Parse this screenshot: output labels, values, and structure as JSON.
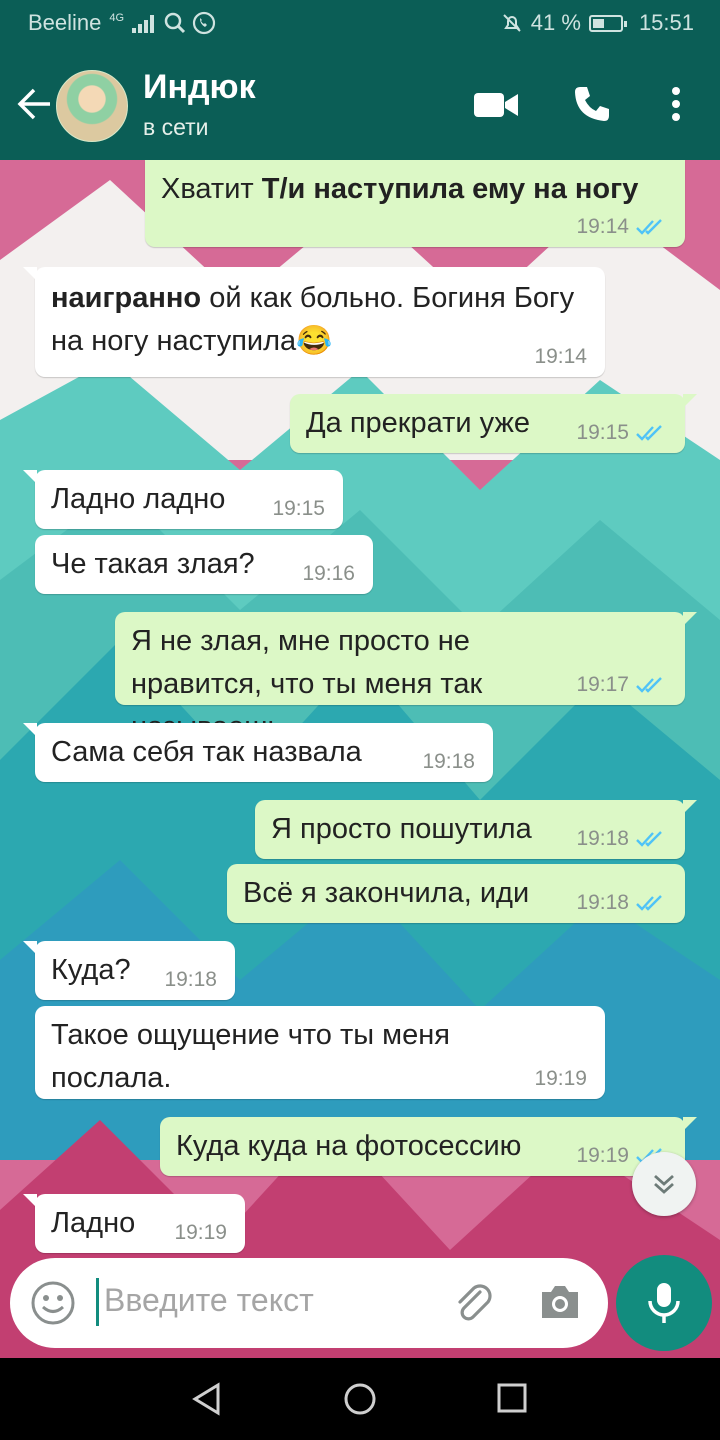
{
  "status_bar": {
    "carrier": "Beeline",
    "network": "4G",
    "battery_percent_text": "41 %",
    "battery_level": 0.41,
    "time": "15:51"
  },
  "header": {
    "contact_name": "Индюк",
    "presence": "в сети"
  },
  "messages": [
    {
      "dir": "out",
      "text": "Хватит ",
      "bold": "Т/и наступила ему на ногу",
      "time": "19:14"
    },
    {
      "dir": "in",
      "bold": "наигранно",
      "text": " ой как больно. Богиня Богу на ногу наступила",
      "emoji": "😂",
      "time": "19:14"
    },
    {
      "dir": "out",
      "text": "Да прекрати уже",
      "time": "19:15"
    },
    {
      "dir": "in",
      "text": "Ладно ладно",
      "time": "19:15"
    },
    {
      "dir": "in",
      "text": "Че такая злая?",
      "time": "19:16"
    },
    {
      "dir": "out",
      "text": "Я не злая, мне просто не нравится, что ты меня так называешь",
      "time": "19:17"
    },
    {
      "dir": "in",
      "text": "Сама себя так назвала",
      "time": "19:18"
    },
    {
      "dir": "out",
      "text": "Я просто пошутила",
      "time": "19:18"
    },
    {
      "dir": "out",
      "text": "Всё я закончила, иди",
      "time": "19:18"
    },
    {
      "dir": "in",
      "text": "Куда?",
      "time": "19:18"
    },
    {
      "dir": "in",
      "text": "Такое ощущение что ты меня послала.",
      "time": "19:19"
    },
    {
      "dir": "out",
      "text": "Куда куда на фотосессию",
      "time": "19:19"
    },
    {
      "dir": "in",
      "text": "Ладно",
      "time": "19:19"
    }
  ],
  "composer": {
    "placeholder": "Введите текст"
  },
  "colors": {
    "header": "#0b5e56",
    "accent": "#128c7e",
    "bubble_out": "#dcf8c6",
    "bubble_in": "#ffffff",
    "read_ticks": "#4fc3f7"
  },
  "icons": [
    "back-arrow-icon",
    "video-call-icon",
    "phone-icon",
    "more-vert-icon",
    "emoji-icon",
    "attach-icon",
    "camera-icon",
    "mic-icon",
    "scroll-down-icon",
    "nav-back-icon",
    "nav-home-icon",
    "nav-recents-icon"
  ]
}
